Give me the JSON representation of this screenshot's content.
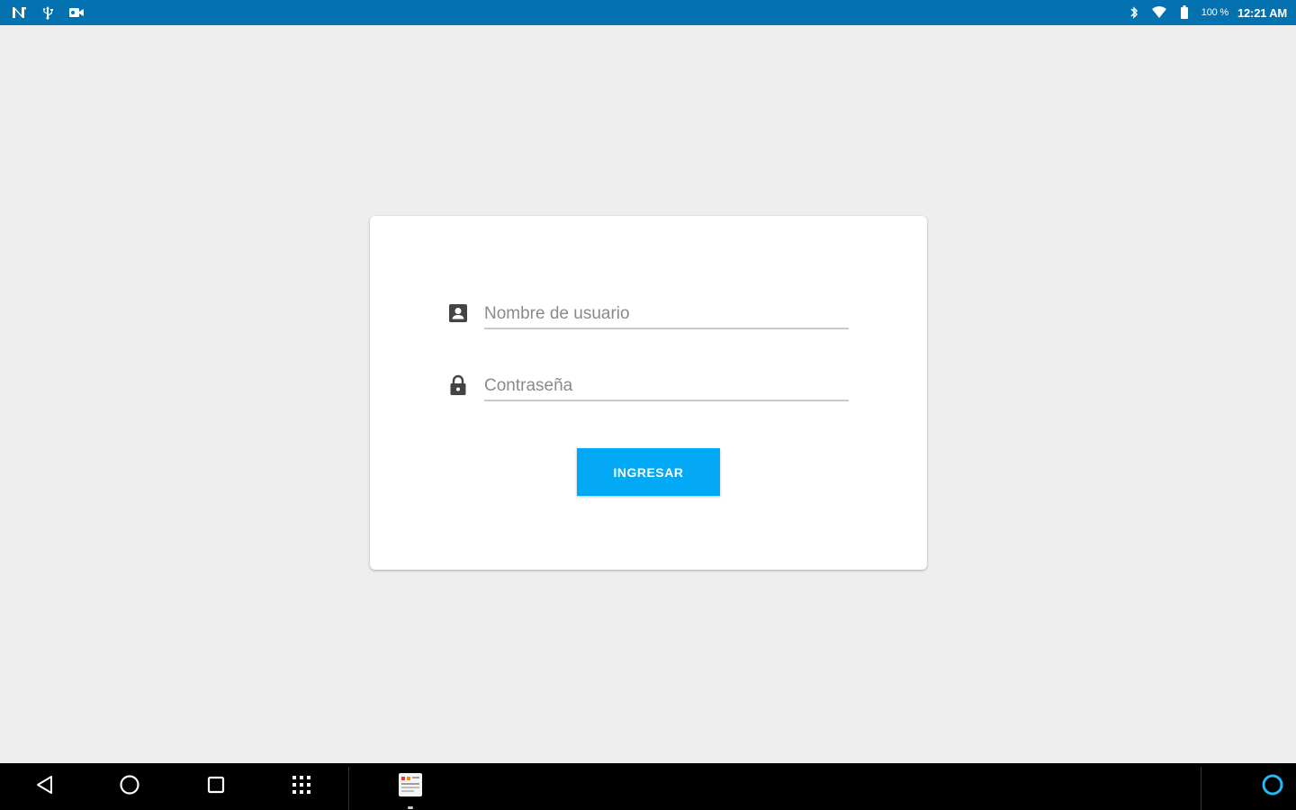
{
  "status_bar": {
    "left_icons": [
      "n-app-icon",
      "usb-icon",
      "video-icon"
    ],
    "right_icons": [
      "bluetooth-icon",
      "wifi-icon",
      "battery-icon"
    ],
    "battery": "100 %",
    "time": "12:21 AM",
    "background_color": "#0471b0"
  },
  "login_form": {
    "username": {
      "placeholder": "Nombre de usuario",
      "value": "",
      "icon": "account-box-icon"
    },
    "password": {
      "placeholder": "Contraseña",
      "value": "",
      "icon": "lock-icon"
    },
    "submit_label": "INGRESAR",
    "accent_color": "#03a9f4"
  },
  "nav_bar": {
    "buttons": [
      "back-icon",
      "home-icon",
      "recents-icon",
      "app-drawer-icon"
    ],
    "pinned_app_icon": "app-icon",
    "assistant_icon": "assistant-icon"
  },
  "colors": {
    "background": "#eeeeee",
    "card": "#ffffff",
    "nav_bar": "#000000"
  }
}
